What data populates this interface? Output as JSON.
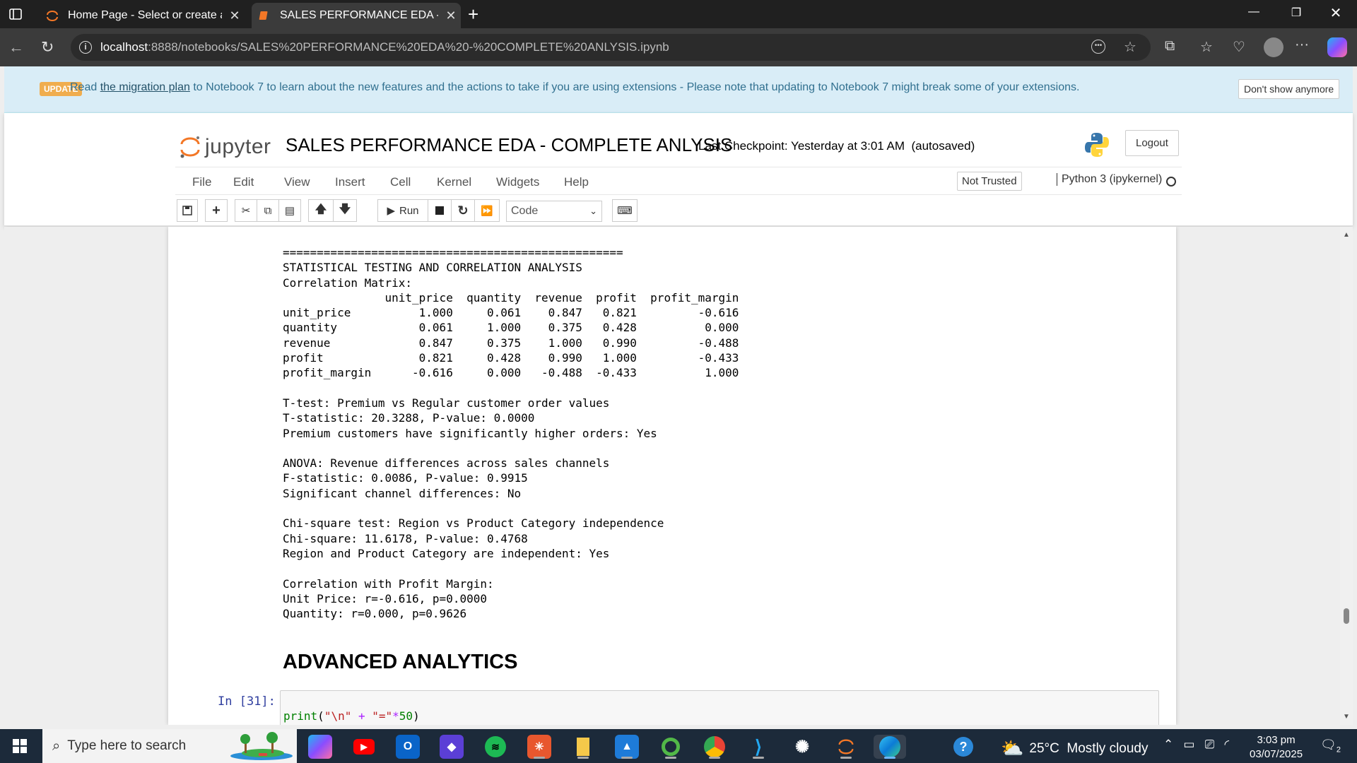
{
  "browser": {
    "tabs": [
      {
        "title": "Home Page - Select or create a notebook",
        "active": false
      },
      {
        "title": "SALES PERFORMANCE EDA - COMPLETE ANLYSIS",
        "active": true
      }
    ],
    "url_host": "localhost",
    "url_rest": ":8888/notebooks/SALES%20PERFORMANCE%20EDA%20-%20COMPLETE%20ANLYSIS.ipynb"
  },
  "banner": {
    "badge": "UPDATE",
    "read": "Read",
    "link": "the migration plan",
    "message": "to Notebook 7 to learn about the new features and the actions to take if you are using extensions - Please note that updating to Notebook 7 might break some of your extensions.",
    "dont_show": "Don't show anymore"
  },
  "header": {
    "logo_text": "jupyter",
    "notebook_title": "SALES PERFORMANCE EDA - COMPLETE ANLYSIS",
    "checkpoint": "Last Checkpoint: Yesterday at 3:01 AM",
    "autosaved": "(autosaved)",
    "logout": "Logout"
  },
  "menu": {
    "items": [
      "File",
      "Edit",
      "View",
      "Insert",
      "Cell",
      "Kernel",
      "Widgets",
      "Help"
    ],
    "not_trusted": "Not Trusted",
    "kernel": "Python 3 (ipykernel)"
  },
  "toolbar": {
    "run_label": "Run",
    "cell_type": "Code"
  },
  "output_lines": [
    "==================================================",
    "STATISTICAL TESTING AND CORRELATION ANALYSIS",
    "Correlation Matrix:",
    "               unit_price  quantity  revenue  profit  profit_margin",
    "unit_price          1.000     0.061    0.847   0.821         -0.616",
    "quantity            0.061     1.000    0.375   0.428          0.000",
    "revenue             0.847     0.375    1.000   0.990         -0.488",
    "profit              0.821     0.428    0.990   1.000         -0.433",
    "profit_margin      -0.616     0.000   -0.488  -0.433          1.000",
    "",
    "T-test: Premium vs Regular customer order values",
    "T-statistic: 20.3288, P-value: 0.0000",
    "Premium customers have significantly higher orders: Yes",
    "",
    "ANOVA: Revenue differences across sales channels",
    "F-statistic: 0.0086, P-value: 0.9915",
    "Significant channel differences: No",
    "",
    "Chi-square test: Region vs Product Category independence",
    "Chi-square: 11.6178, P-value: 0.4768",
    "Region and Product Category are independent: Yes",
    "",
    "Correlation with Profit Margin:",
    "Unit Price: r=-0.616, p=0.0000",
    "Quantity: r=0.000, p=0.9626"
  ],
  "markdown_heading": "ADVANCED ANALYTICS",
  "code_cell": {
    "prompt": "In [31]:",
    "fn": "print",
    "open": "(",
    "str1": "\"\\n\"",
    "plus": " + ",
    "str2": "\"=\"",
    "star": "*",
    "num": "50",
    "close": ")"
  },
  "taskbar": {
    "search_placeholder": "Type here to search",
    "weather_temp": "25°C",
    "weather_text": "Mostly cloudy",
    "time": "3:03 pm",
    "date": "03/07/2025",
    "notifications": "2"
  },
  "colors": {
    "jupyter_orange": "#f37726",
    "prompt_blue": "#303f9f",
    "banner_bg": "#d9edf7"
  }
}
